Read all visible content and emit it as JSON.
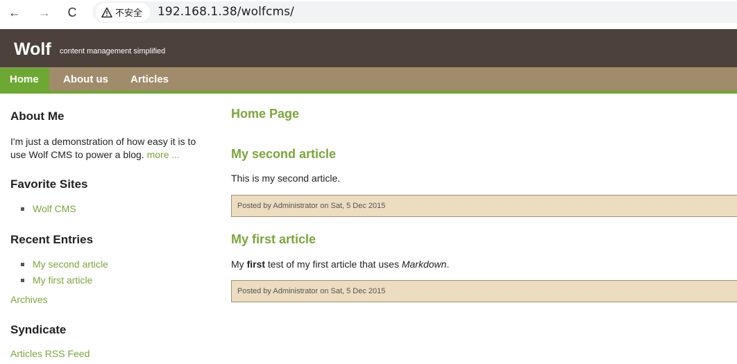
{
  "browser": {
    "back_glyph": "←",
    "forward_glyph": "→",
    "reload_glyph": "C",
    "security_label": "不安全",
    "url": "192.168.1.38/wolfcms/"
  },
  "site": {
    "title": "Wolf",
    "slogan": "content management simplified"
  },
  "nav": {
    "items": [
      {
        "label": "Home",
        "active": true
      },
      {
        "label": "About us",
        "active": false
      },
      {
        "label": "Articles",
        "active": false
      }
    ]
  },
  "sidebar": {
    "about": {
      "heading": "About Me",
      "text": "I'm just a demonstration of how easy it is to use Wolf CMS to power a blog.",
      "more_link": "more ..."
    },
    "favorites": {
      "heading": "Favorite Sites",
      "items": [
        "Wolf CMS"
      ]
    },
    "recent": {
      "heading": "Recent Entries",
      "items": [
        "My second article",
        "My first article"
      ],
      "archives_link": "Archives"
    },
    "syndicate": {
      "heading": "Syndicate",
      "feed_link": "Articles RSS Feed"
    }
  },
  "main": {
    "page_heading": "Home Page",
    "articles": [
      {
        "title": "My second article",
        "body": "This is my second article.",
        "meta": "Posted by Administrator on Sat, 5 Dec 2015"
      },
      {
        "title": "My first article",
        "body_prefix": "My ",
        "body_bold": "first",
        "body_middle": " test of my first article that uses ",
        "body_italic": "Markdown",
        "body_suffix": ".",
        "meta": "Posted by Administrator on Sat, 5 Dec 2015"
      }
    ]
  },
  "colors": {
    "header_bg": "#4d423b",
    "nav_bg": "#a08b6b",
    "accent_green": "#6da832",
    "link_green": "#7aa63a",
    "meta_bg": "#ecdcc0"
  }
}
